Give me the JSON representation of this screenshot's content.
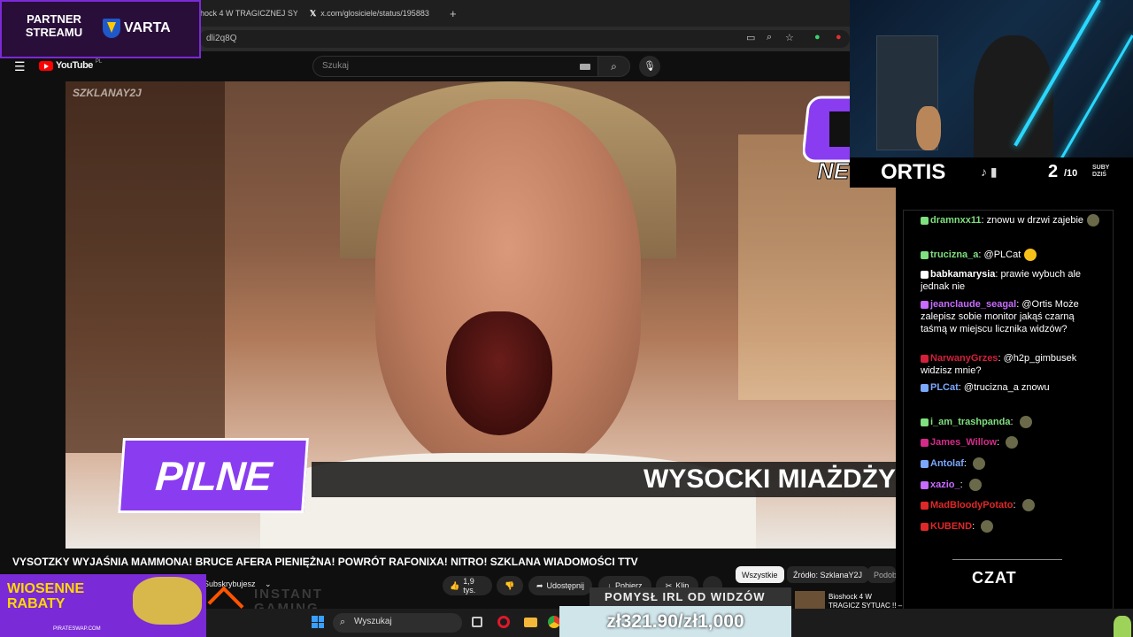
{
  "browser": {
    "tabs": [
      {
        "label": "hock 4 W TRAGICZNEJ SYT",
        "icon": "youtube-icon"
      },
      {
        "label": "x.com/glosiciele/status/195883",
        "icon": "x-icon"
      }
    ],
    "new_tab": "+",
    "address": "dli2q8Q"
  },
  "youtube": {
    "logo": "YouTube",
    "region": "PL",
    "search_placeholder": "Szukaj"
  },
  "video": {
    "watermark": "SZKLANAY2J",
    "pilne": "PILNE",
    "ticker": "WYSOCKI MIAŻDŻY M",
    "news_label": "NEWS"
  },
  "below_video": {
    "title": "VYSOTZKY WYJAŚNIA MAMMONA! BRUCE AFERA PIENIĘŻNA! POWRÓT RAFONIXA! NITRO! SZKLANA WIADOMOŚCI TTV",
    "subscribe": "Subskrybujesz",
    "likes": "1,9 tys.",
    "share": "Udostępnij",
    "download": "Pobierz",
    "clip": "Klip",
    "more": "...",
    "chips": [
      "Wszystkie",
      "Źródło: SzklanaY2J",
      "Podobne"
    ]
  },
  "sponsor": {
    "partner_line1": "PARTNER",
    "partner_line2": "STREAMU",
    "varta": "VARTA"
  },
  "stream": {
    "streamer": "ORTIS",
    "socials": "♪ ▮",
    "subs_current": "2",
    "subs_goal": "/10",
    "subs_label_1": "SUBY",
    "subs_label_2": "DZIŚ",
    "chat_label": "CZAT",
    "idea_label": "POMYSŁ IRL OD WIDZÓW",
    "counter": "zł321.90/zł1,000"
  },
  "chat": [
    {
      "user": "dramnxx11",
      "color": "#7ee07e",
      "text": "znowu w drzwi zajebie"
    },
    {
      "user": "trucizna_a",
      "color": "#7ee07e",
      "text": "@PLCat"
    },
    {
      "user": "babkamarysia",
      "color": "#ffffff",
      "text": "prawie wybuch ale jednak nie"
    },
    {
      "user": "jeanclaude_seagal",
      "color": "#c86bff",
      "text": "@Ortis Może zalepisz sobie monitor jakąś czarną taśmą w miejscu licznika widzów?"
    },
    {
      "user": "NarwanyGrzes",
      "color": "#d4203a",
      "text": "@h2p_gimbusek widzisz mnie?"
    },
    {
      "user": "PLCat",
      "color": "#7aa8ff",
      "text": "@trucizna_a znowu"
    },
    {
      "user": "i_am_trashpanda",
      "color": "#7ee07e",
      "text": ""
    },
    {
      "user": "James_Willow",
      "color": "#d42a8a",
      "text": ""
    },
    {
      "user": "Antolaf",
      "color": "#7aa8ff",
      "text": ""
    },
    {
      "user": "xazio_",
      "color": "#c86bff",
      "text": ""
    },
    {
      "user": "MadBloodyPotato",
      "color": "#e02828",
      "text": ""
    },
    {
      "user": "KUBEND",
      "color": "#e02828",
      "text": ""
    }
  ],
  "ads": {
    "wiosenne_1": "WIOSENNE",
    "wiosenne_2": "RABATY",
    "pirate": "PIRATESWAP.COM",
    "instant_1": "INSTANT",
    "instant_2": "GAMING"
  },
  "taskbar": {
    "search": "Wyszukaj"
  },
  "suggested": {
    "title": "Bioshock 4 W TRAGICZ SYTUAC !! – Zagraj w"
  }
}
